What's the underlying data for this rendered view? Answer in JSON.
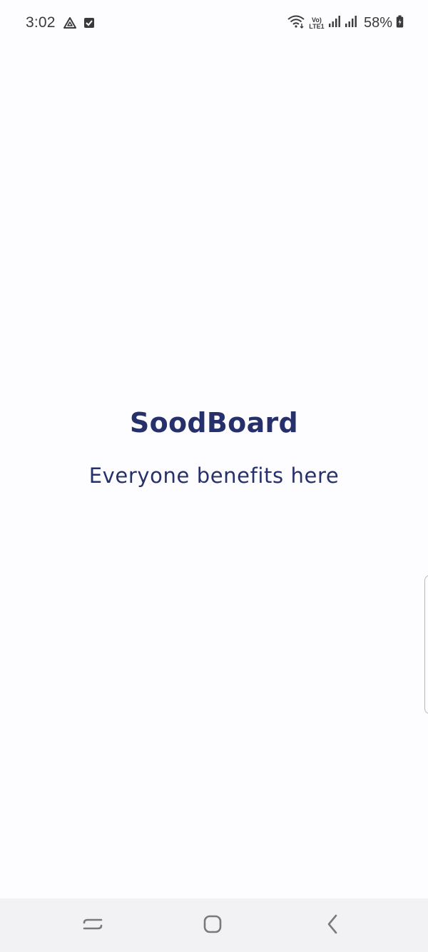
{
  "status_bar": {
    "time": "3:02",
    "left_icons": [
      "drive-triangle-icon",
      "checkbox-icon"
    ],
    "network_label_top": "Vo)",
    "network_label_bottom": "LTE1",
    "right_icons": [
      "wifi-icon",
      "signal-icon-1",
      "signal-icon-2",
      "battery-charging-icon"
    ],
    "battery": "58%"
  },
  "splash": {
    "title": "SoodBoard",
    "tagline": "Everyone benefits here"
  },
  "nav_bar": {
    "buttons": [
      "recents-icon",
      "home-icon",
      "back-icon"
    ]
  },
  "colors": {
    "background": "#fdfcfe",
    "brand": "#26306a",
    "status_text": "#3a3a3a",
    "nav_background": "#f2f1f3"
  }
}
